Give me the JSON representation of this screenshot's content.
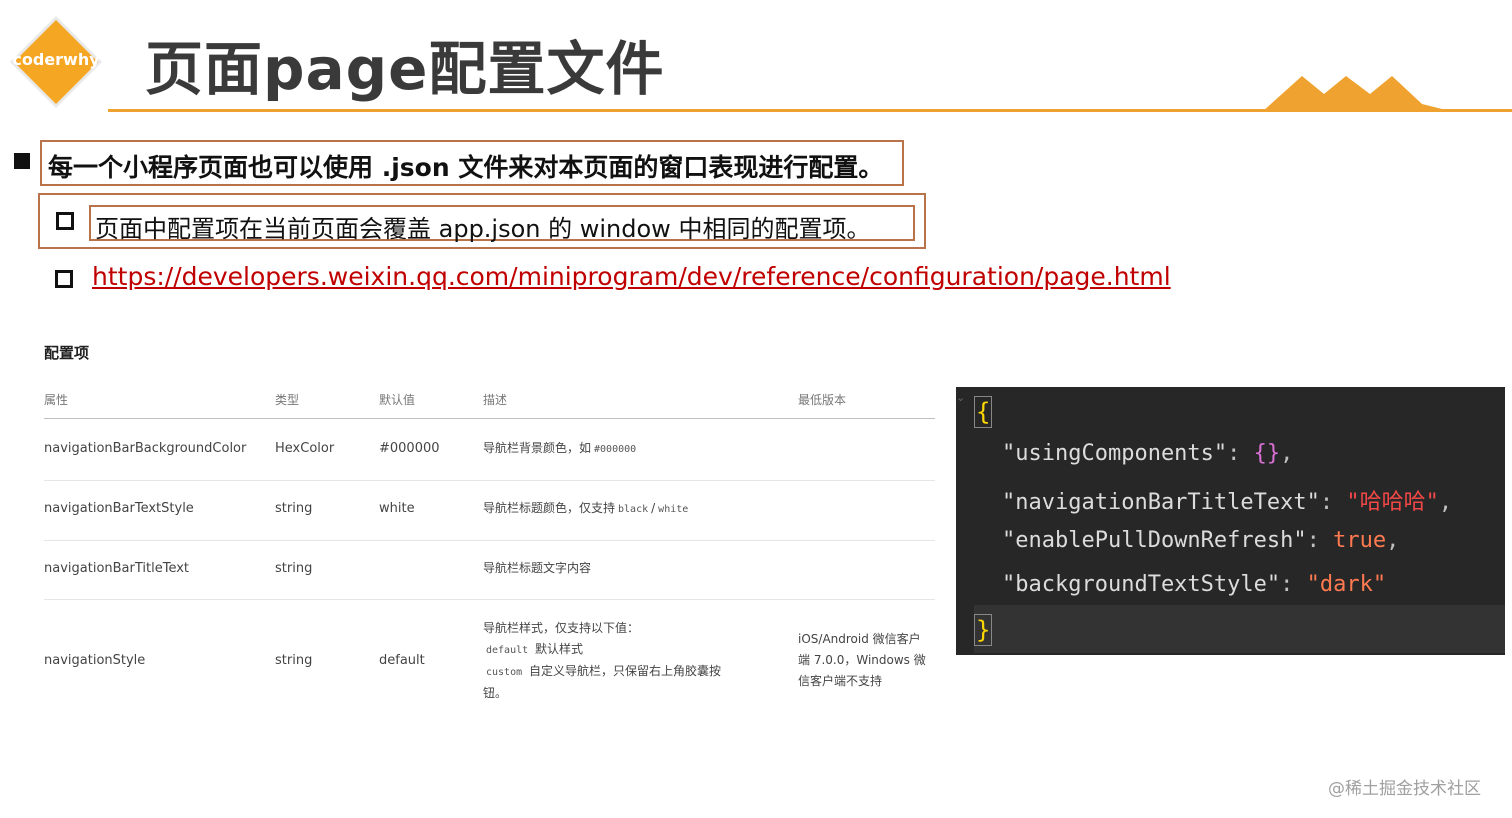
{
  "header": {
    "logo_text": "coderwhy",
    "title": "页面page配置文件",
    "accent_color": "#f0a230"
  },
  "bullets": {
    "main": "每一个小程序页面也可以使用 .json 文件来对本页面的窗口表现进行配置。",
    "sub": "页面中配置项在当前页面会覆盖 app.json 的 window 中相同的配置项。",
    "link": "https://developers.weixin.qq.com/miniprogram/dev/reference/configuration/page.html"
  },
  "config_table": {
    "title": "配置项",
    "headers": [
      "属性",
      "类型",
      "默认值",
      "描述",
      "最低版本"
    ],
    "rows": [
      {
        "attr": "navigationBarBackgroundColor",
        "type": "HexColor",
        "default": "#000000",
        "desc": "导航栏背景颜色，如",
        "desc_code": "#000000",
        "min_version": ""
      },
      {
        "attr": "navigationBarTextStyle",
        "type": "string",
        "default": "white",
        "desc": "导航栏标题颜色，仅支持",
        "desc_code": "black",
        "desc_sep": "/",
        "desc_code2": "white",
        "min_version": ""
      },
      {
        "attr": "navigationBarTitleText",
        "type": "string",
        "default": "",
        "desc": "导航栏标题文字内容",
        "min_version": ""
      },
      {
        "attr": "navigationStyle",
        "type": "string",
        "default": "default",
        "desc_line1": "导航栏样式，仅支持以下值：",
        "desc_code_a": "default",
        "desc_line2": "默认样式",
        "desc_code_b": "custom",
        "desc_line3": "自定义导航栏，只保留右上角胶囊按",
        "desc_line4": "钮。",
        "min_version_line1": "iOS/Android 微信客户",
        "min_version_line2": "端 7.0.0，Windows 微",
        "min_version_line3": "信客户端不支持"
      }
    ]
  },
  "code": {
    "open_brace": "{",
    "close_brace": "}",
    "lines": [
      {
        "key": "\"usingComponents\"",
        "colon": ": ",
        "value": "{}",
        "end": ","
      },
      {
        "key": "\"navigationBarTitleText\"",
        "colon": ": ",
        "value": "\"哈哈哈\"",
        "end": ","
      },
      {
        "key": "\"enablePullDownRefresh\"",
        "colon": ": ",
        "value": "true",
        "end": ","
      },
      {
        "key": "\"backgroundTextStyle\"",
        "colon": ": ",
        "value": "\"dark\"",
        "end": ""
      }
    ]
  },
  "watermark": "@稀土掘金技术社区"
}
